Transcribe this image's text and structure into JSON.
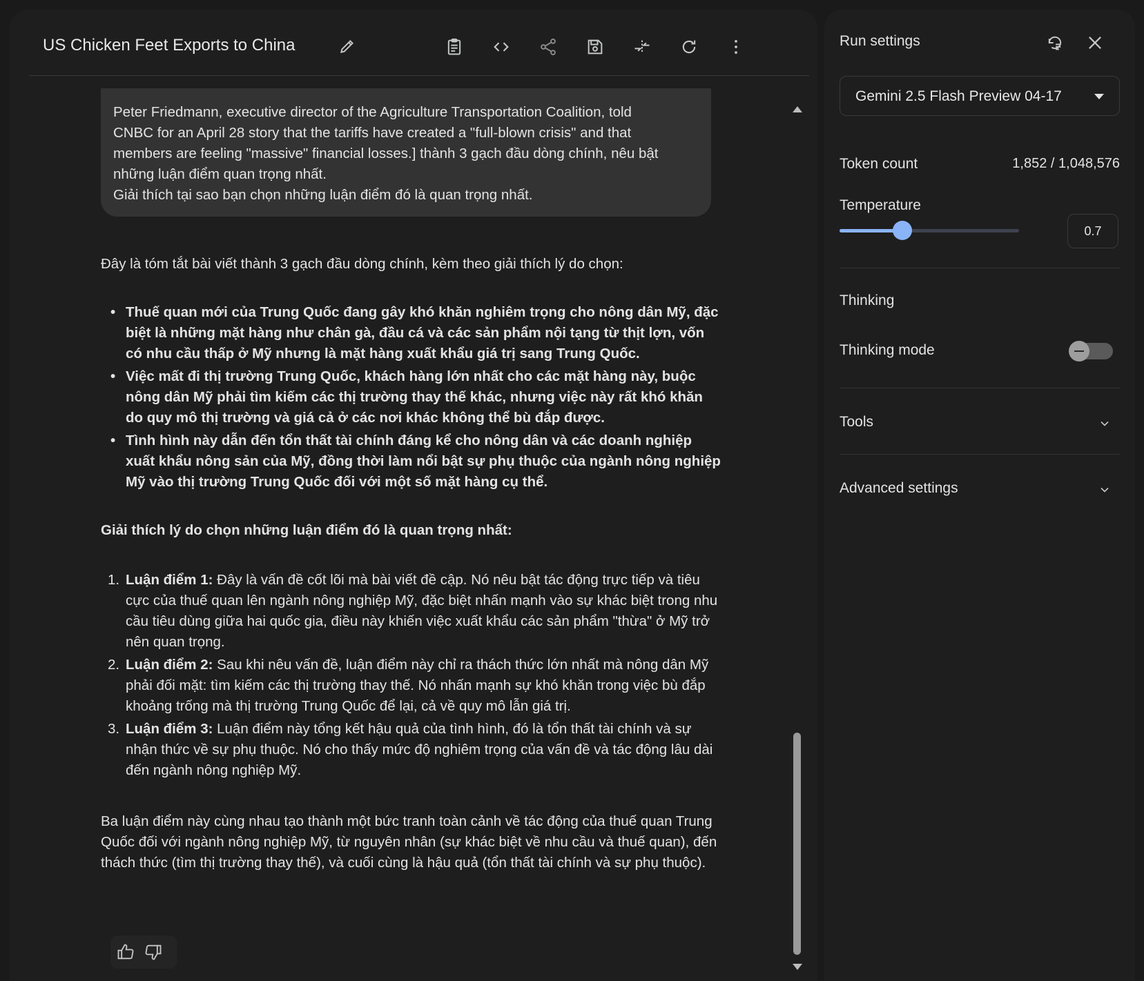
{
  "header": {
    "title": "US Chicken Feet Exports to China",
    "icons": [
      "edit-icon",
      "prompt-doc-icon",
      "code-icon",
      "share-icon",
      "save-icon",
      "compare-icon",
      "refresh-icon",
      "more-vert-icon"
    ]
  },
  "chat": {
    "user_message": [
      "Peter Friedmann, executive director of the Agriculture Transportation Coalition, told",
      "CNBC for an April 28 story that the tariffs have created a \"full-blown crisis\" and that",
      "members are feeling \"massive\" financial losses.] thành 3 gạch đầu dòng chính, nêu bật",
      "những luận điểm quan trọng nhất.",
      "Giải thích tại sao bạn chọn những luận điểm đó là quan trọng nhất."
    ],
    "response": {
      "intro": "Đây là tóm tắt bài viết thành 3 gạch đầu dòng chính, kèm theo giải thích lý do chọn:",
      "bullets": [
        "Thuế quan mới của Trung Quốc đang gây khó khăn nghiêm trọng cho nông dân Mỹ, đặc biệt là những mặt hàng như chân gà, đầu cá và các sản phẩm nội tạng từ thịt lợn, vốn có nhu cầu thấp ở Mỹ nhưng là mặt hàng xuất khẩu giá trị sang Trung Quốc.",
        "Việc mất đi thị trường Trung Quốc, khách hàng lớn nhất cho các mặt hàng này, buộc nông dân Mỹ phải tìm kiếm các thị trường thay thế khác, nhưng việc này rất khó khăn do quy mô thị trường và giá cả ở các nơi khác không thể bù đắp được.",
        "Tình hình này dẫn đến tổn thất tài chính đáng kể cho nông dân và các doanh nghiệp xuất khẩu nông sản của Mỹ, đồng thời làm nổi bật sự phụ thuộc của ngành nông nghiệp Mỹ vào thị trường Trung Quốc đối với một số mặt hàng cụ thể."
      ],
      "subhead": "Giải thích lý do chọn những luận điểm đó là quan trọng nhất:",
      "points": [
        {
          "num": "1.",
          "label": "Luận điểm 1:",
          "text": " Đây là vấn đề cốt lõi mà bài viết đề cập. Nó nêu bật tác động trực tiếp và tiêu cực của thuế quan lên ngành nông nghiệp Mỹ, đặc biệt nhấn mạnh vào sự khác biệt trong nhu cầu tiêu dùng giữa hai quốc gia, điều này khiến việc xuất khẩu các sản phẩm \"thừa\" ở Mỹ trở nên quan trọng."
        },
        {
          "num": "2.",
          "label": "Luận điểm 2:",
          "text": " Sau khi nêu vấn đề, luận điểm này chỉ ra thách thức lớn nhất mà nông dân Mỹ phải đối mặt: tìm kiếm các thị trường thay thế. Nó nhấn mạnh sự khó khăn trong việc bù đắp khoảng trống mà thị trường Trung Quốc để lại, cả về quy mô lẫn giá trị."
        },
        {
          "num": "3.",
          "label": "Luận điểm 3:",
          "text": " Luận điểm này tổng kết hậu quả của tình hình, đó là tổn thất tài chính và sự nhận thức về sự phụ thuộc. Nó cho thấy mức độ nghiêm trọng của vấn đề và tác động lâu dài đến ngành nông nghiệp Mỹ."
        }
      ],
      "conclusion": "Ba luận điểm này cùng nhau tạo thành một bức tranh toàn cảnh về tác động của thuế quan Trung Quốc đối với ngành nông nghiệp Mỹ, từ nguyên nhân (sự khác biệt về nhu cầu và thuế quan), đến thách thức (tìm thị trường thay thế), và cuối cùng là hậu quả (tổn thất tài chính và sự phụ thuộc)."
    }
  },
  "run_settings": {
    "title": "Run settings",
    "model": "Gemini 2.5 Flash Preview 04-17",
    "token_count_label": "Token count",
    "token_count_value": "1,852 / 1,048,576",
    "temperature_label": "Temperature",
    "temperature_value": "0.7",
    "temperature_fraction": 0.35,
    "thinking_heading": "Thinking",
    "thinking_mode_label": "Thinking mode",
    "thinking_mode_on": false,
    "tools_label": "Tools",
    "advanced_label": "Advanced settings"
  },
  "colors": {
    "accent": "#8ab4f8",
    "panel_bg": "#1e1e1e",
    "page_bg": "#1a1a1a",
    "bubble_bg": "#333333"
  }
}
